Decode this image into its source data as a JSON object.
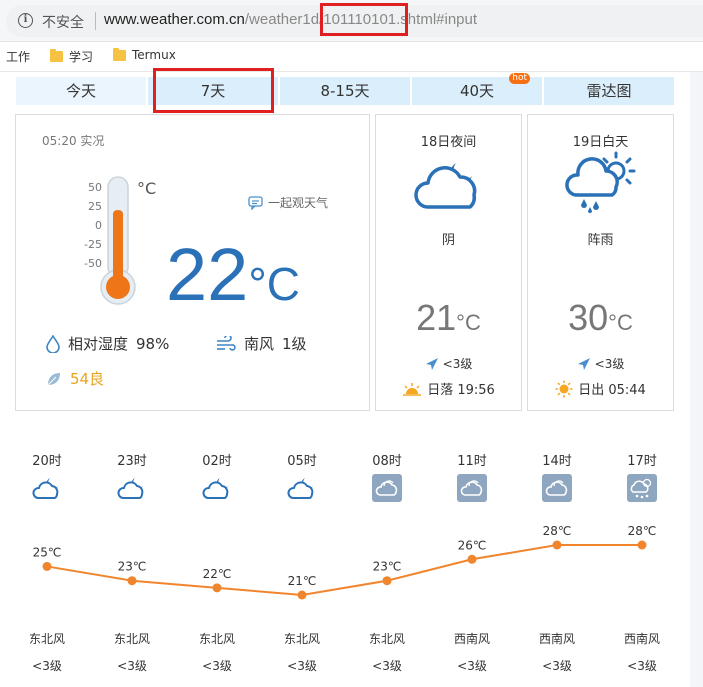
{
  "browser": {
    "insecure_label": "不安全",
    "url_host": "www.weather.com.cn",
    "url_path_a": "/weather1d/",
    "url_path_id": "101110101",
    "url_path_b": ".shtml#input"
  },
  "bookmarks": [
    {
      "label": "工作"
    },
    {
      "label": "学习"
    },
    {
      "label": "Termux"
    }
  ],
  "tabs": [
    {
      "label": "今天"
    },
    {
      "label": "7天"
    },
    {
      "label": "8-15天"
    },
    {
      "label": "40天",
      "badge": "hot"
    },
    {
      "label": "雷达图"
    }
  ],
  "current": {
    "obs_time": "05:20 实况",
    "scale": [
      "50",
      "25",
      "0",
      "-25",
      "-50"
    ],
    "scale_unit": "°C",
    "watch_label": "一起观天气",
    "temp": "22",
    "temp_unit": "°C",
    "humidity_label": "相对湿度",
    "humidity_value": "98%",
    "wind_label": "南风",
    "wind_value": "1级",
    "aqi": "54良",
    "thermometer_level": 0.72
  },
  "forecast": [
    {
      "label": "18日夜间",
      "weather": "阴",
      "temp": "21",
      "unit": "°C",
      "wind": "<3级",
      "sun": "日落 19:56",
      "icon": "night-cloudy-icon"
    },
    {
      "label": "19日白天",
      "weather": "阵雨",
      "temp": "30",
      "unit": "°C",
      "wind": "<3级",
      "sun": "日出 05:44",
      "icon": "shower-icon"
    }
  ],
  "hourly": [
    {
      "time": "20时",
      "temp": 25,
      "temp_label": "25℃",
      "dir": "东北风",
      "level": "<3级",
      "icon": "night-cloudy-icon"
    },
    {
      "time": "23时",
      "temp": 23,
      "temp_label": "23℃",
      "dir": "东北风",
      "level": "<3级",
      "icon": "night-cloudy-icon"
    },
    {
      "time": "02时",
      "temp": 22,
      "temp_label": "22℃",
      "dir": "东北风",
      "level": "<3级",
      "icon": "night-cloudy-icon"
    },
    {
      "time": "05时",
      "temp": 21,
      "temp_label": "21℃",
      "dir": "东北风",
      "level": "<3级",
      "icon": "night-cloudy-icon"
    },
    {
      "time": "08时",
      "temp": 23,
      "temp_label": "23℃",
      "dir": "东北风",
      "level": "<3级",
      "icon": "overcast-icon"
    },
    {
      "time": "11时",
      "temp": 26,
      "temp_label": "26℃",
      "dir": "西南风",
      "level": "<3级",
      "icon": "overcast-icon"
    },
    {
      "time": "14时",
      "temp": 28,
      "temp_label": "28℃",
      "dir": "西南风",
      "level": "<3级",
      "icon": "overcast-icon"
    },
    {
      "time": "17时",
      "temp": 28,
      "temp_label": "28℃",
      "dir": "西南风",
      "level": "<3级",
      "icon": "shower-icon"
    }
  ],
  "chart_data": {
    "type": "line",
    "categories": [
      "20时",
      "23时",
      "02时",
      "05时",
      "08时",
      "11时",
      "14时",
      "17时"
    ],
    "values": [
      25,
      23,
      22,
      21,
      23,
      26,
      28,
      28
    ],
    "color": "#f0852d",
    "grid": false
  },
  "colors": {
    "temp_blue": "#2a71b7",
    "aqi_yellow": "#e9a41c",
    "line_orange": "#f0852d",
    "tab_blue": "#dbeefb",
    "annotation_red": "#e02020"
  }
}
